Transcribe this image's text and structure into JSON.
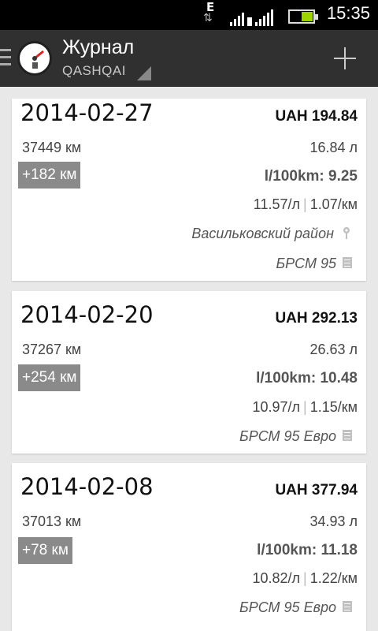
{
  "statusbar": {
    "network": "E",
    "time": "15:35"
  },
  "actionbar": {
    "title": "Журнал",
    "subtitle": "QASHQAI"
  },
  "entries": [
    {
      "date": "2014-02-27",
      "cost": "UAH 194.84",
      "odometer": "37449 км",
      "volume": "16.84 л",
      "distance": "+182 км",
      "consumption": "l/100km: 9.25",
      "price_per_liter": "11.57/л",
      "price_per_km": "1.07/км",
      "location": "Васильковский район",
      "fuel": "БРСМ 95"
    },
    {
      "date": "2014-02-20",
      "cost": "UAH 292.13",
      "odometer": "37267 км",
      "volume": "26.63 л",
      "distance": "+254 км",
      "consumption": "l/100km: 10.48",
      "price_per_liter": "10.97/л",
      "price_per_km": "1.15/км",
      "fuel": "БРСМ 95 Евро"
    },
    {
      "date": "2014-02-08",
      "cost": "UAH 377.94",
      "odometer": "37013 км",
      "volume": "34.93 л",
      "distance": "+78 км",
      "consumption": "l/100km: 11.18",
      "price_per_liter": "10.82/л",
      "price_per_km": "1.22/км",
      "fuel": "БРСМ 95 Евро"
    }
  ],
  "icons": {
    "menu": "menu-icon",
    "app": "fuel-gauge-icon",
    "add": "plus-icon",
    "location": "location-pin-icon",
    "note": "note-icon"
  },
  "colors": {
    "actionbar": "#303030",
    "distance_badge": "#8a8a8a",
    "battery": "#9ed300"
  }
}
